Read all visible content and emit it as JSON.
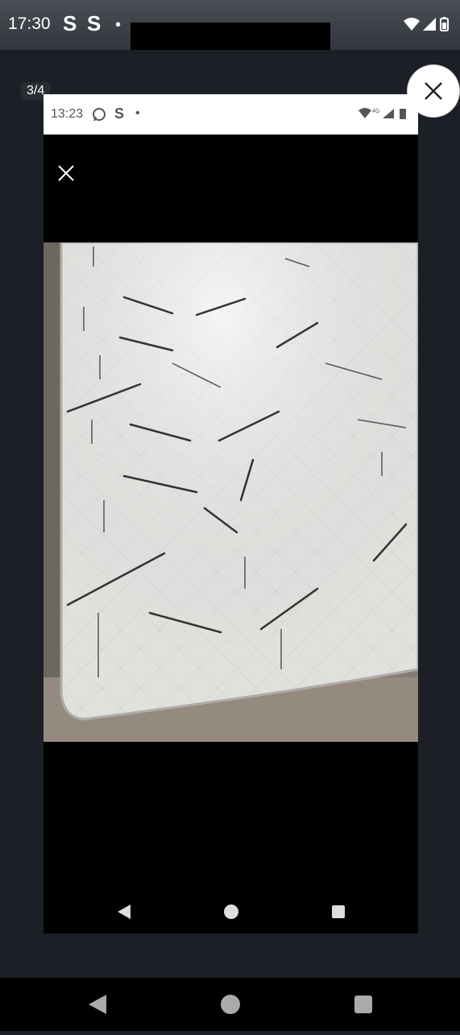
{
  "status_bar": {
    "time": "17:30",
    "app_icon_1": "S",
    "app_icon_2": "S",
    "dot": "•",
    "icons": [
      "wifi-icon",
      "signal-icon",
      "battery-icon"
    ]
  },
  "viewer": {
    "counter": "3/4",
    "close_icon": "close-icon"
  },
  "screenshot": {
    "status_bar": {
      "time": "13:23",
      "app_icons": "S",
      "dot": "•",
      "network": "4G"
    },
    "close_icon": "close-icon",
    "photo": "mattress-photo",
    "nav_icons": [
      "back-icon",
      "home-icon",
      "recents-icon"
    ]
  },
  "system_nav": {
    "icons": [
      "back-icon",
      "home-icon",
      "recents-icon"
    ]
  },
  "colors": {
    "background": "#1c1f26",
    "status_bar": "#3d4047",
    "shot_bg": "#000000",
    "mattress": "#eeeeec"
  }
}
